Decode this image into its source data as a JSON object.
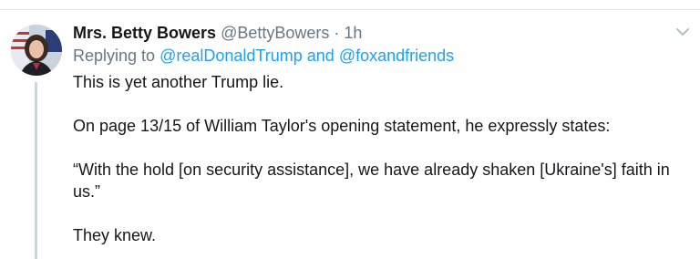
{
  "tweet": {
    "author": {
      "display_name": "Mrs. Betty Bowers",
      "handle": "@BettyBowers",
      "avatar_icon": "profile-photo"
    },
    "separator": "·",
    "timestamp": "1h",
    "reply": {
      "prefix": "Replying to",
      "mention_1": "@realDonaldTrump",
      "conjunction": "and",
      "mention_2": "@foxandfriends"
    },
    "paragraphs": [
      "This is yet another Trump lie.",
      "On page 13/15 of William Taylor's opening statement, he expressly states:",
      "“With the hold [on security assistance], we have already shaken [Ukraine's] faith in us.”",
      "They knew."
    ],
    "menu_icon": "chevron-down-icon"
  },
  "colors": {
    "text": "#14171a",
    "secondary": "#657786",
    "link": "#1da1f2",
    "thread_line": "#ccd6dd"
  }
}
